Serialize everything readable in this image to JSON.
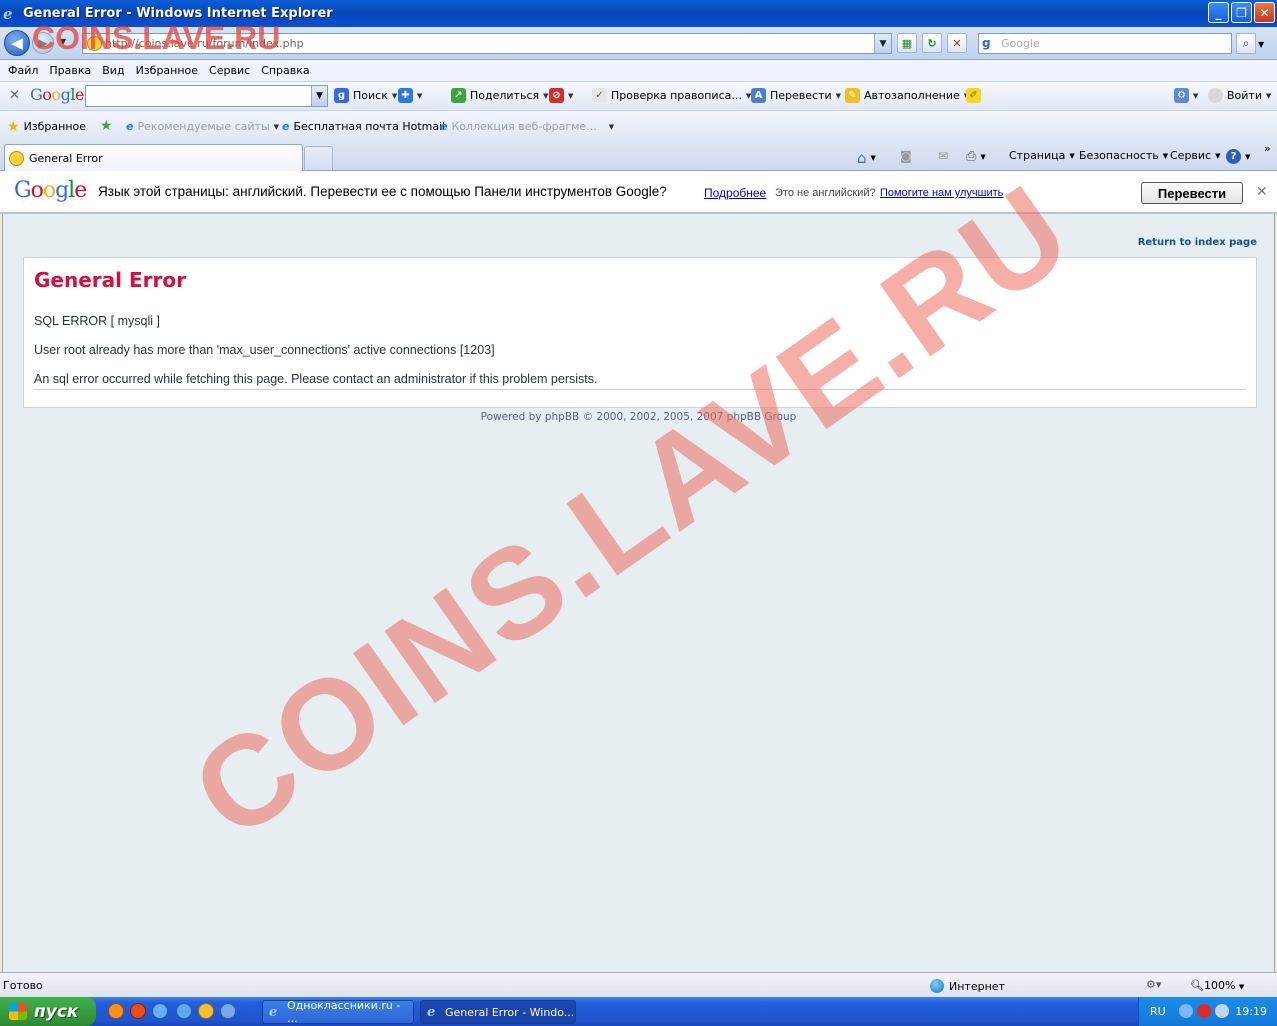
{
  "window": {
    "title": "General Error - Windows Internet Explorer",
    "buttons": [
      "_",
      "❐",
      "✕"
    ]
  },
  "addressbar": {
    "url": "http://coins.lave.ru/forum/index.php",
    "search_placeholder": "Google"
  },
  "menu": [
    "Файл",
    "Правка",
    "Вид",
    "Избранное",
    "Сервис",
    "Справка"
  ],
  "google_toolbar": {
    "logo": "Google",
    "search": "Поиск",
    "share": "Поделиться",
    "spellcheck": "Проверка правописа...",
    "translate": "Перевести",
    "autofill": "Автозаполнение",
    "signin": "Войти"
  },
  "favorites": {
    "label": "Избранное",
    "suggested": "Рекомендуемые сайты",
    "hotmail": "Бесплатная почта Hotmail",
    "webslices": "Коллекция веб-фрагме..."
  },
  "tabs": [
    {
      "label": "General Error"
    }
  ],
  "commandbar": {
    "page": "Страница",
    "safety": "Безопасность",
    "tools": "Сервис"
  },
  "translate_bar": {
    "logo": "Google",
    "message": "Язык этой страницы: английский. Перевести ее с помощью Панели инструментов Google?",
    "more": "Подробнее",
    "not_english": "Это не английский?",
    "help": "Помогите нам улучшить",
    "button": "Перевести",
    "close": "✕"
  },
  "content": {
    "return_link": "Return to index page",
    "error_title": "General Error",
    "sql_error": "SQL ERROR [ mysqli ]",
    "message": "User root already has more than 'max_user_connections' active connections [1203]",
    "notice": "An sql error occurred while fetching this page. Please contact an administrator if this problem persists.",
    "powered_by": "Powered by phpBB © 2000, 2002, 2005, 2007 phpBB Group"
  },
  "watermark": {
    "top": "COINS.LAVE.RU",
    "diagonal": "COINS.LAVE.RU"
  },
  "status": {
    "text": "Готово",
    "zone": "Интернет",
    "zoom": "100%"
  },
  "taskbar": {
    "start": "пуск",
    "items": [
      {
        "label": "Одноклассники.ru - ..."
      },
      {
        "label": "General Error - Windo..."
      }
    ],
    "lang": "RU",
    "time": "19:19"
  }
}
